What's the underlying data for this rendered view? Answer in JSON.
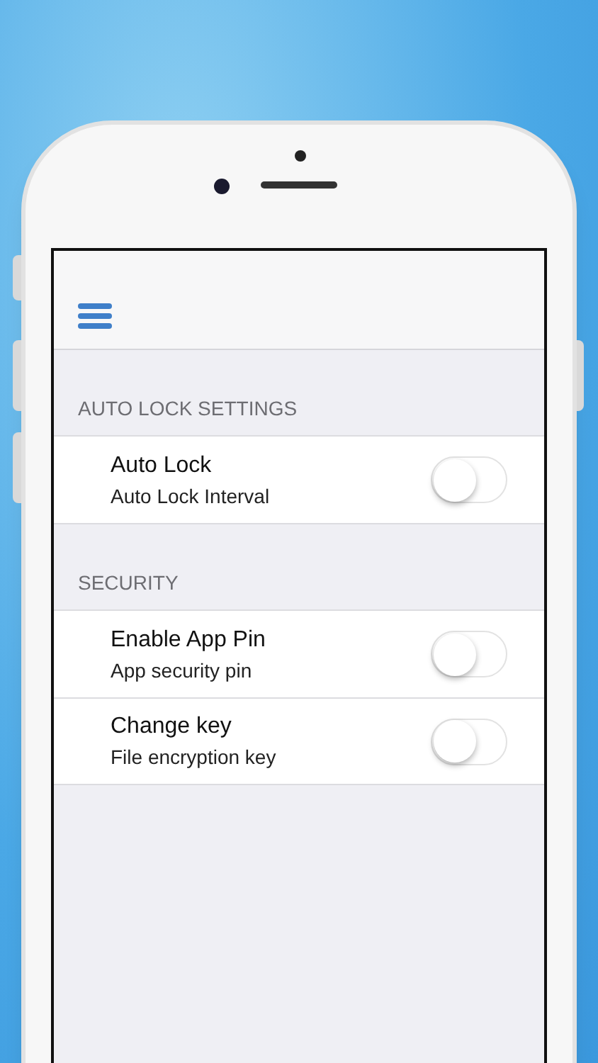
{
  "sections": [
    {
      "header": "AUTO LOCK SETTINGS",
      "rows": [
        {
          "title": "Auto Lock",
          "subtitle": "Auto Lock Interval",
          "on": false
        }
      ]
    },
    {
      "header": "SECURITY",
      "rows": [
        {
          "title": "Enable App Pin",
          "subtitle": "App security pin",
          "on": false
        },
        {
          "title": "Change key",
          "subtitle": "File encryption key",
          "on": false
        }
      ]
    }
  ]
}
